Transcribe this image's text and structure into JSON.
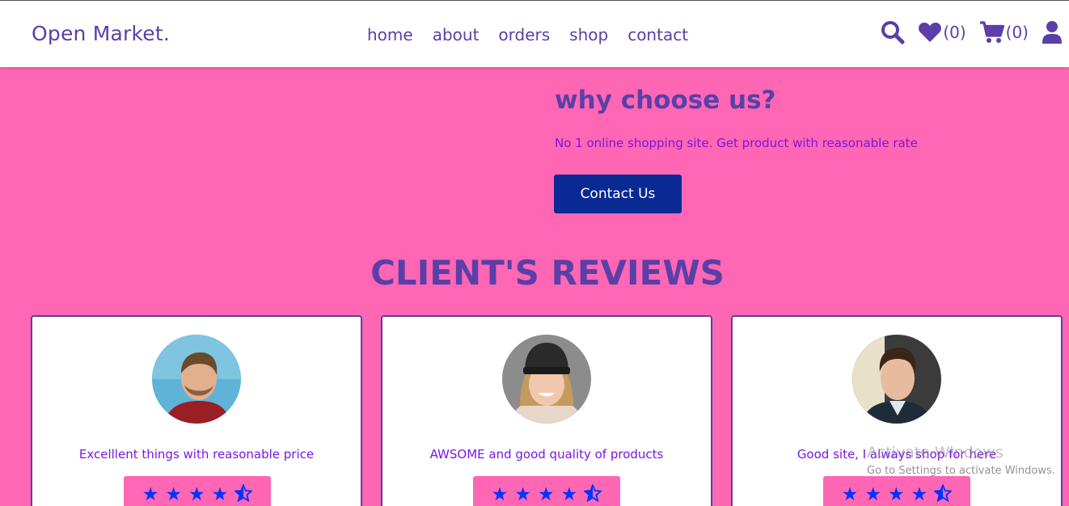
{
  "header": {
    "logo": "Open Market.",
    "nav": [
      "home",
      "about",
      "orders",
      "shop",
      "contact"
    ],
    "wishlist_count": "(0)",
    "cart_count": "(0)"
  },
  "why": {
    "title": "why choose us?",
    "text": "No 1 online shopping site. Get product with reasonable rate",
    "button": "Contact Us"
  },
  "reviews": {
    "title": "CLIENT'S REVIEWS",
    "items": [
      {
        "text": "Excelllent things with reasonable price",
        "rating": 4.5
      },
      {
        "text": "AWSOME and good quality of products",
        "rating": 4.5
      },
      {
        "text": "Good site, I always shop for here",
        "rating": 4.5
      }
    ]
  },
  "watermark": {
    "title": "Activate Windows",
    "subtitle": "Go to Settings to activate Windows."
  },
  "colors": {
    "background": "#ff66b3",
    "accent": "#5a3fa8",
    "button": "#0a2a93",
    "text_purple": "#7a17e0",
    "star": "#0033ff"
  }
}
